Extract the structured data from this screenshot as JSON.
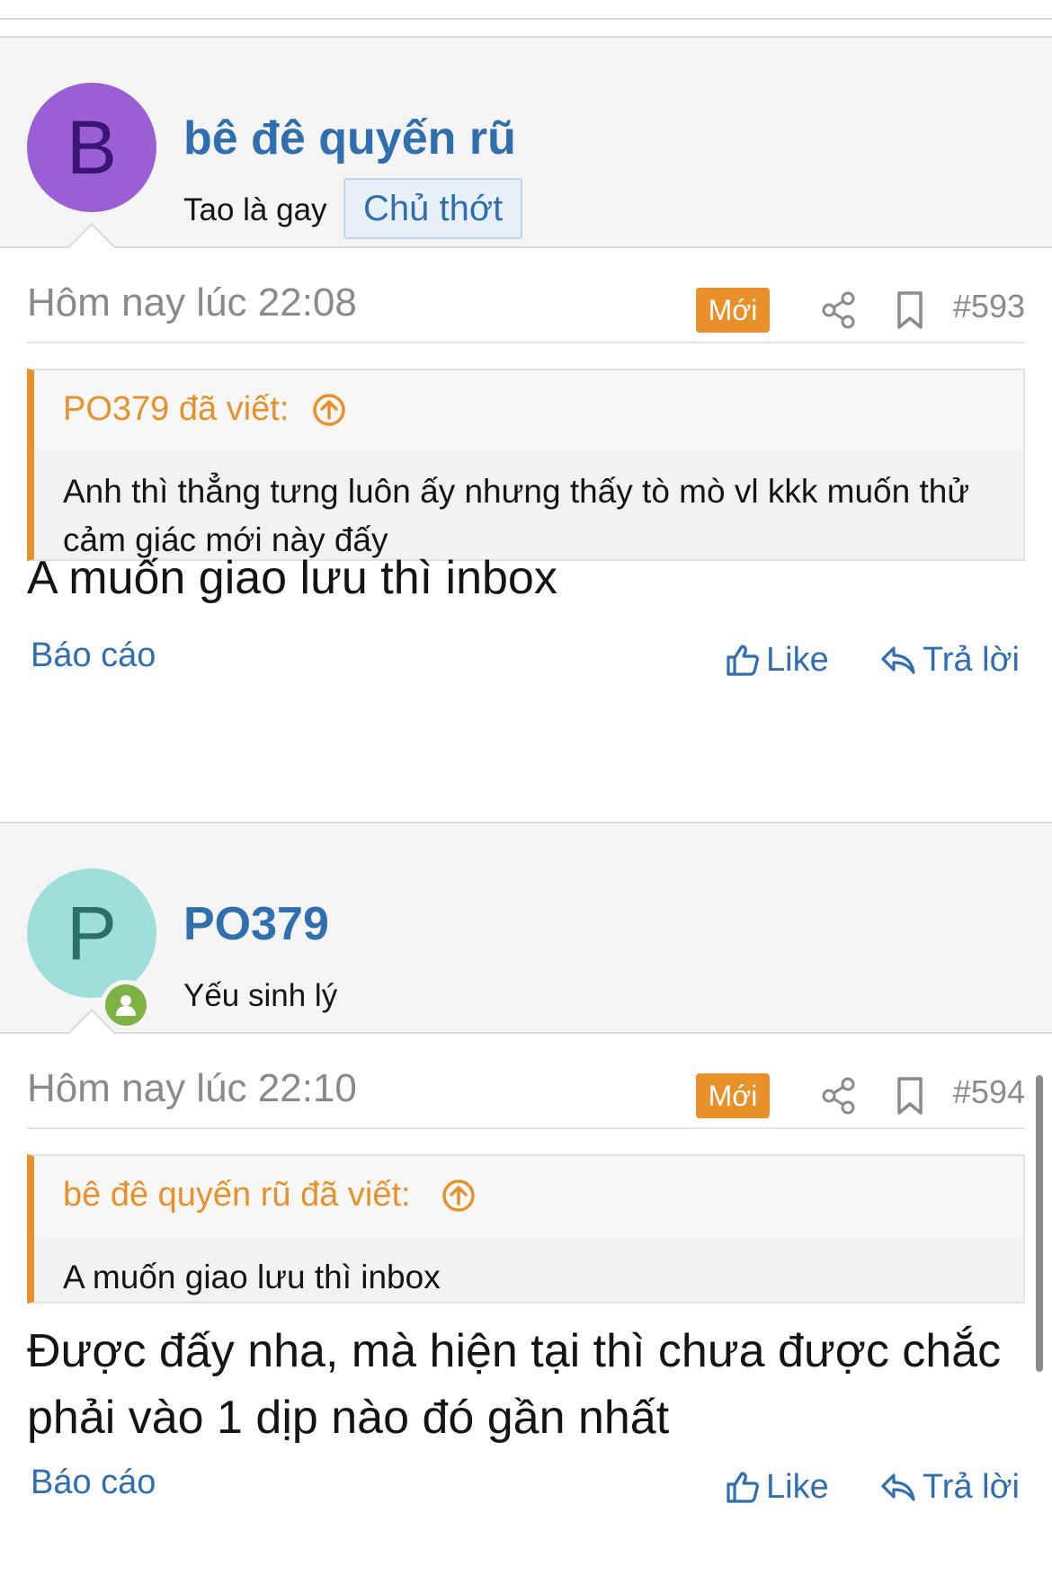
{
  "colors": {
    "accent": "#2f6fb0",
    "new_badge": "#e8902a",
    "online": "#7cb342"
  },
  "posts": [
    {
      "avatar": {
        "letter": "B",
        "bg": "#9c5ed4",
        "fg": "#3a1573"
      },
      "username": "bê đê quyến rũ",
      "user_title": "Tao là gay",
      "role_badge": "Chủ thớt",
      "time": "Hôm nay lúc 22:08",
      "new_label": "Mới",
      "post_number": "#593",
      "quote": {
        "author": "PO379 đã viết:",
        "text": "Anh thì thẳng tưng luôn ấy nhưng thấy tò mò vl kkk muốn thử cảm giác mới này đấy"
      },
      "message": "A muốn giao lưu thì inbox",
      "actions": {
        "report": "Báo cáo",
        "like": "Like",
        "reply": "Trả lời"
      }
    },
    {
      "avatar": {
        "letter": "P",
        "bg": "#9fdfdb",
        "fg": "#2c6f6a",
        "online_icon": "user-icon"
      },
      "username": "PO379",
      "user_title": "Yếu sinh lý",
      "time": "Hôm nay lúc 22:10",
      "new_label": "Mới",
      "post_number": "#594",
      "quote": {
        "author": "bê đê quyến rũ đã viết:",
        "text": "A muốn giao lưu thì inbox"
      },
      "message": "Được đấy nha, mà hiện tại thì chưa được chắc phải vào 1 dịp nào đó gần nhất",
      "actions": {
        "report": "Báo cáo",
        "like": "Like",
        "reply": "Trả lời"
      }
    }
  ]
}
